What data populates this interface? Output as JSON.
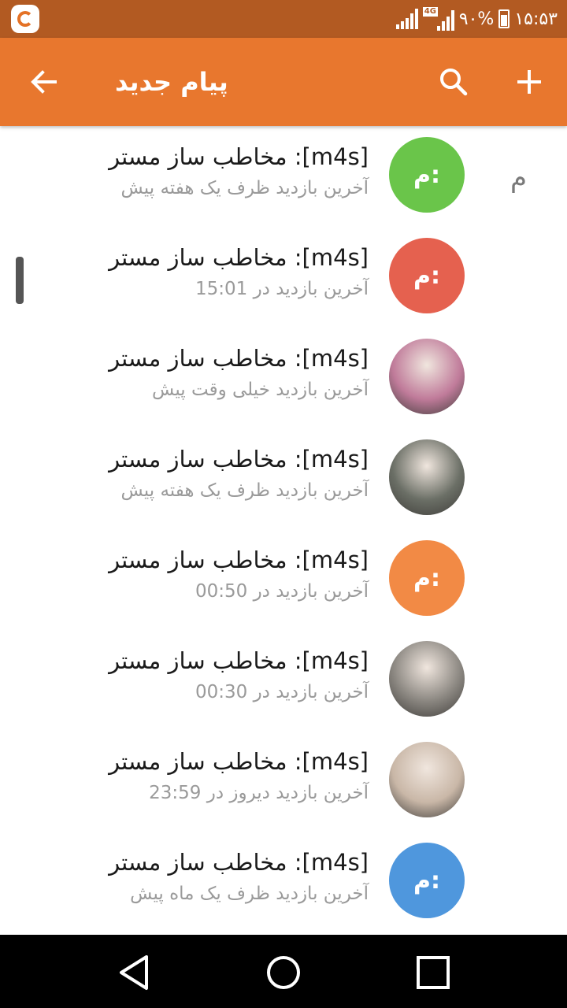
{
  "status_bar": {
    "battery_text": "۹۰%",
    "time": "۱۵:۵۳",
    "network_tag": "4G"
  },
  "appbar": {
    "title": "پیام جدید",
    "color": "#e8772e",
    "icons": [
      "back-arrow-icon",
      "search-icon",
      "add-icon"
    ]
  },
  "list": {
    "section_letter": "م",
    "rows": [
      {
        "name": "مخاطب ساز مستر :[m4s]",
        "status": "آخرین بازدید ظرف یک هفته پیش",
        "avatar_text": "م:",
        "avatar_color": "#6ac54a",
        "avatar_type": "initials"
      },
      {
        "name": "مخاطب ساز مستر :[m4s]",
        "status": "آخرین بازدید در 15:01",
        "avatar_text": "م:",
        "avatar_color": "#e5614f",
        "avatar_type": "initials"
      },
      {
        "name": "مخاطب ساز مستر :[m4s]",
        "status": "آخرین بازدید خیلی وقت پیش",
        "avatar_text": "",
        "avatar_color": "#c07b9a",
        "avatar_type": "photo"
      },
      {
        "name": "مخاطب ساز مستر :[m4s]",
        "status": "آخرین بازدید ظرف یک هفته پیش",
        "avatar_text": "",
        "avatar_color": "#6b6f66",
        "avatar_type": "photo"
      },
      {
        "name": "مخاطب ساز مستر :[m4s]",
        "status": "آخرین بازدید در 00:50",
        "avatar_text": "م:",
        "avatar_color": "#f28a45",
        "avatar_type": "initials"
      },
      {
        "name": "مخاطب ساز مستر :[m4s]",
        "status": "آخرین بازدید در 00:30",
        "avatar_text": "",
        "avatar_color": "#8a8680",
        "avatar_type": "photo"
      },
      {
        "name": "مخاطب ساز مستر :[m4s]",
        "status": "آخرین بازدید دیروز در 23:59",
        "avatar_text": "",
        "avatar_color": "#c9b7a7",
        "avatar_type": "photo"
      },
      {
        "name": "مخاطب ساز مستر :[m4s]",
        "status": "آخرین بازدید ظرف یک ماه پیش",
        "avatar_text": "م:",
        "avatar_color": "#4f97dd",
        "avatar_type": "initials"
      }
    ]
  },
  "nav_bar": {
    "icons": [
      "nav-back-icon",
      "nav-home-icon",
      "nav-recent-icon"
    ]
  }
}
